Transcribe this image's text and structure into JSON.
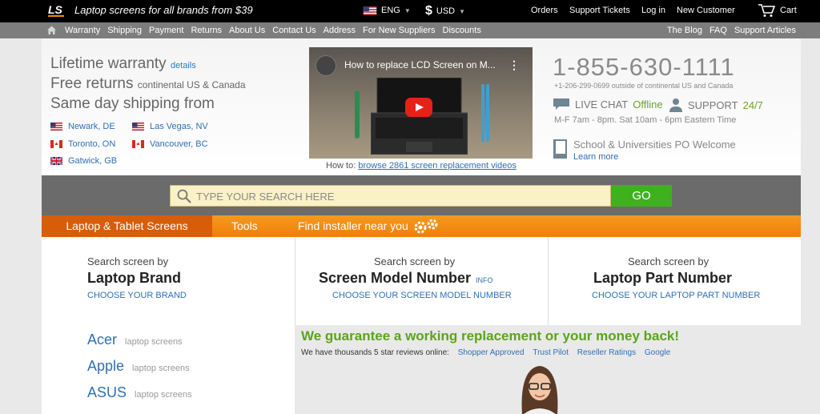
{
  "topbar": {
    "logo": "LS",
    "tagline": "Laptop screens for all brands from $39",
    "language": "ENG",
    "currency": "USD",
    "currency_symbol": "$",
    "links": {
      "orders": "Orders",
      "tickets": "Support Tickets",
      "login": "Log in",
      "new_customer": "New Customer",
      "cart": "Cart"
    }
  },
  "nav": {
    "left": [
      "Warranty",
      "Shipping",
      "Payment",
      "Returns",
      "About Us",
      "Contact Us",
      "Address",
      "For New Suppliers",
      "Discounts"
    ],
    "right": [
      "The Blog",
      "FAQ",
      "Support Articles"
    ]
  },
  "hero": {
    "line1": "Lifetime warranty",
    "line1_link": "details",
    "line2": "Free returns",
    "line2_small": "continental US & Canada",
    "line3": "Same day shipping from",
    "locations": [
      "Newark, DE",
      "Las Vegas, NV",
      "Toronto, ON",
      "Vancouver, BC",
      "Gatwick, GB"
    ],
    "video_title": "How to replace LCD Screen on M...",
    "video_caption_prefix": "How to:",
    "video_caption_link": "browse 2861 screen replacement videos",
    "phone": "1-855-630-1111",
    "phone_alt": "+1-206-299-0699 outside of continental US and Canada",
    "live_chat": "LIVE CHAT",
    "chat_status": "Offline",
    "support": "SUPPORT",
    "support_hours": "24/7",
    "hours": "M-F 7am - 8pm. Sat 10am - 6pm Eastern Time",
    "school": "School & Universities PO Welcome",
    "learn_more": "Learn more"
  },
  "search": {
    "placeholder": "TYPE YOUR SEARCH HERE",
    "go": "GO"
  },
  "tabs": {
    "laptop": "Laptop & Tablet Screens",
    "tools": "Tools",
    "find": "Find installer near you"
  },
  "columns": {
    "c1": {
      "pre": "Search screen by",
      "big": "Laptop Brand",
      "link": "CHOOSE YOUR BRAND"
    },
    "c2": {
      "pre": "Search screen by",
      "big": "Screen Model Number",
      "info": "INFO",
      "link": "CHOOSE YOUR SCREEN MODEL NUMBER"
    },
    "c3": {
      "pre": "Search screen by",
      "big": "Laptop Part Number",
      "link": "CHOOSE YOUR LAPTOP PART NUMBER"
    }
  },
  "brands": [
    {
      "name": "Acer",
      "sub": "laptop screens"
    },
    {
      "name": "Apple",
      "sub": "laptop screens"
    },
    {
      "name": "ASUS",
      "sub": "laptop screens"
    }
  ],
  "guarantee": {
    "headline": "We guarantee a working replacement or your money back!",
    "reviews": "We have thousands 5 star reviews online:",
    "sites": [
      "Shopper Approved",
      "Trust Pilot",
      "Reseller Ratings",
      "Google"
    ]
  },
  "colors": {
    "orange": "#f08a12",
    "green": "#3fb11e",
    "blue": "#2f6fb5"
  }
}
